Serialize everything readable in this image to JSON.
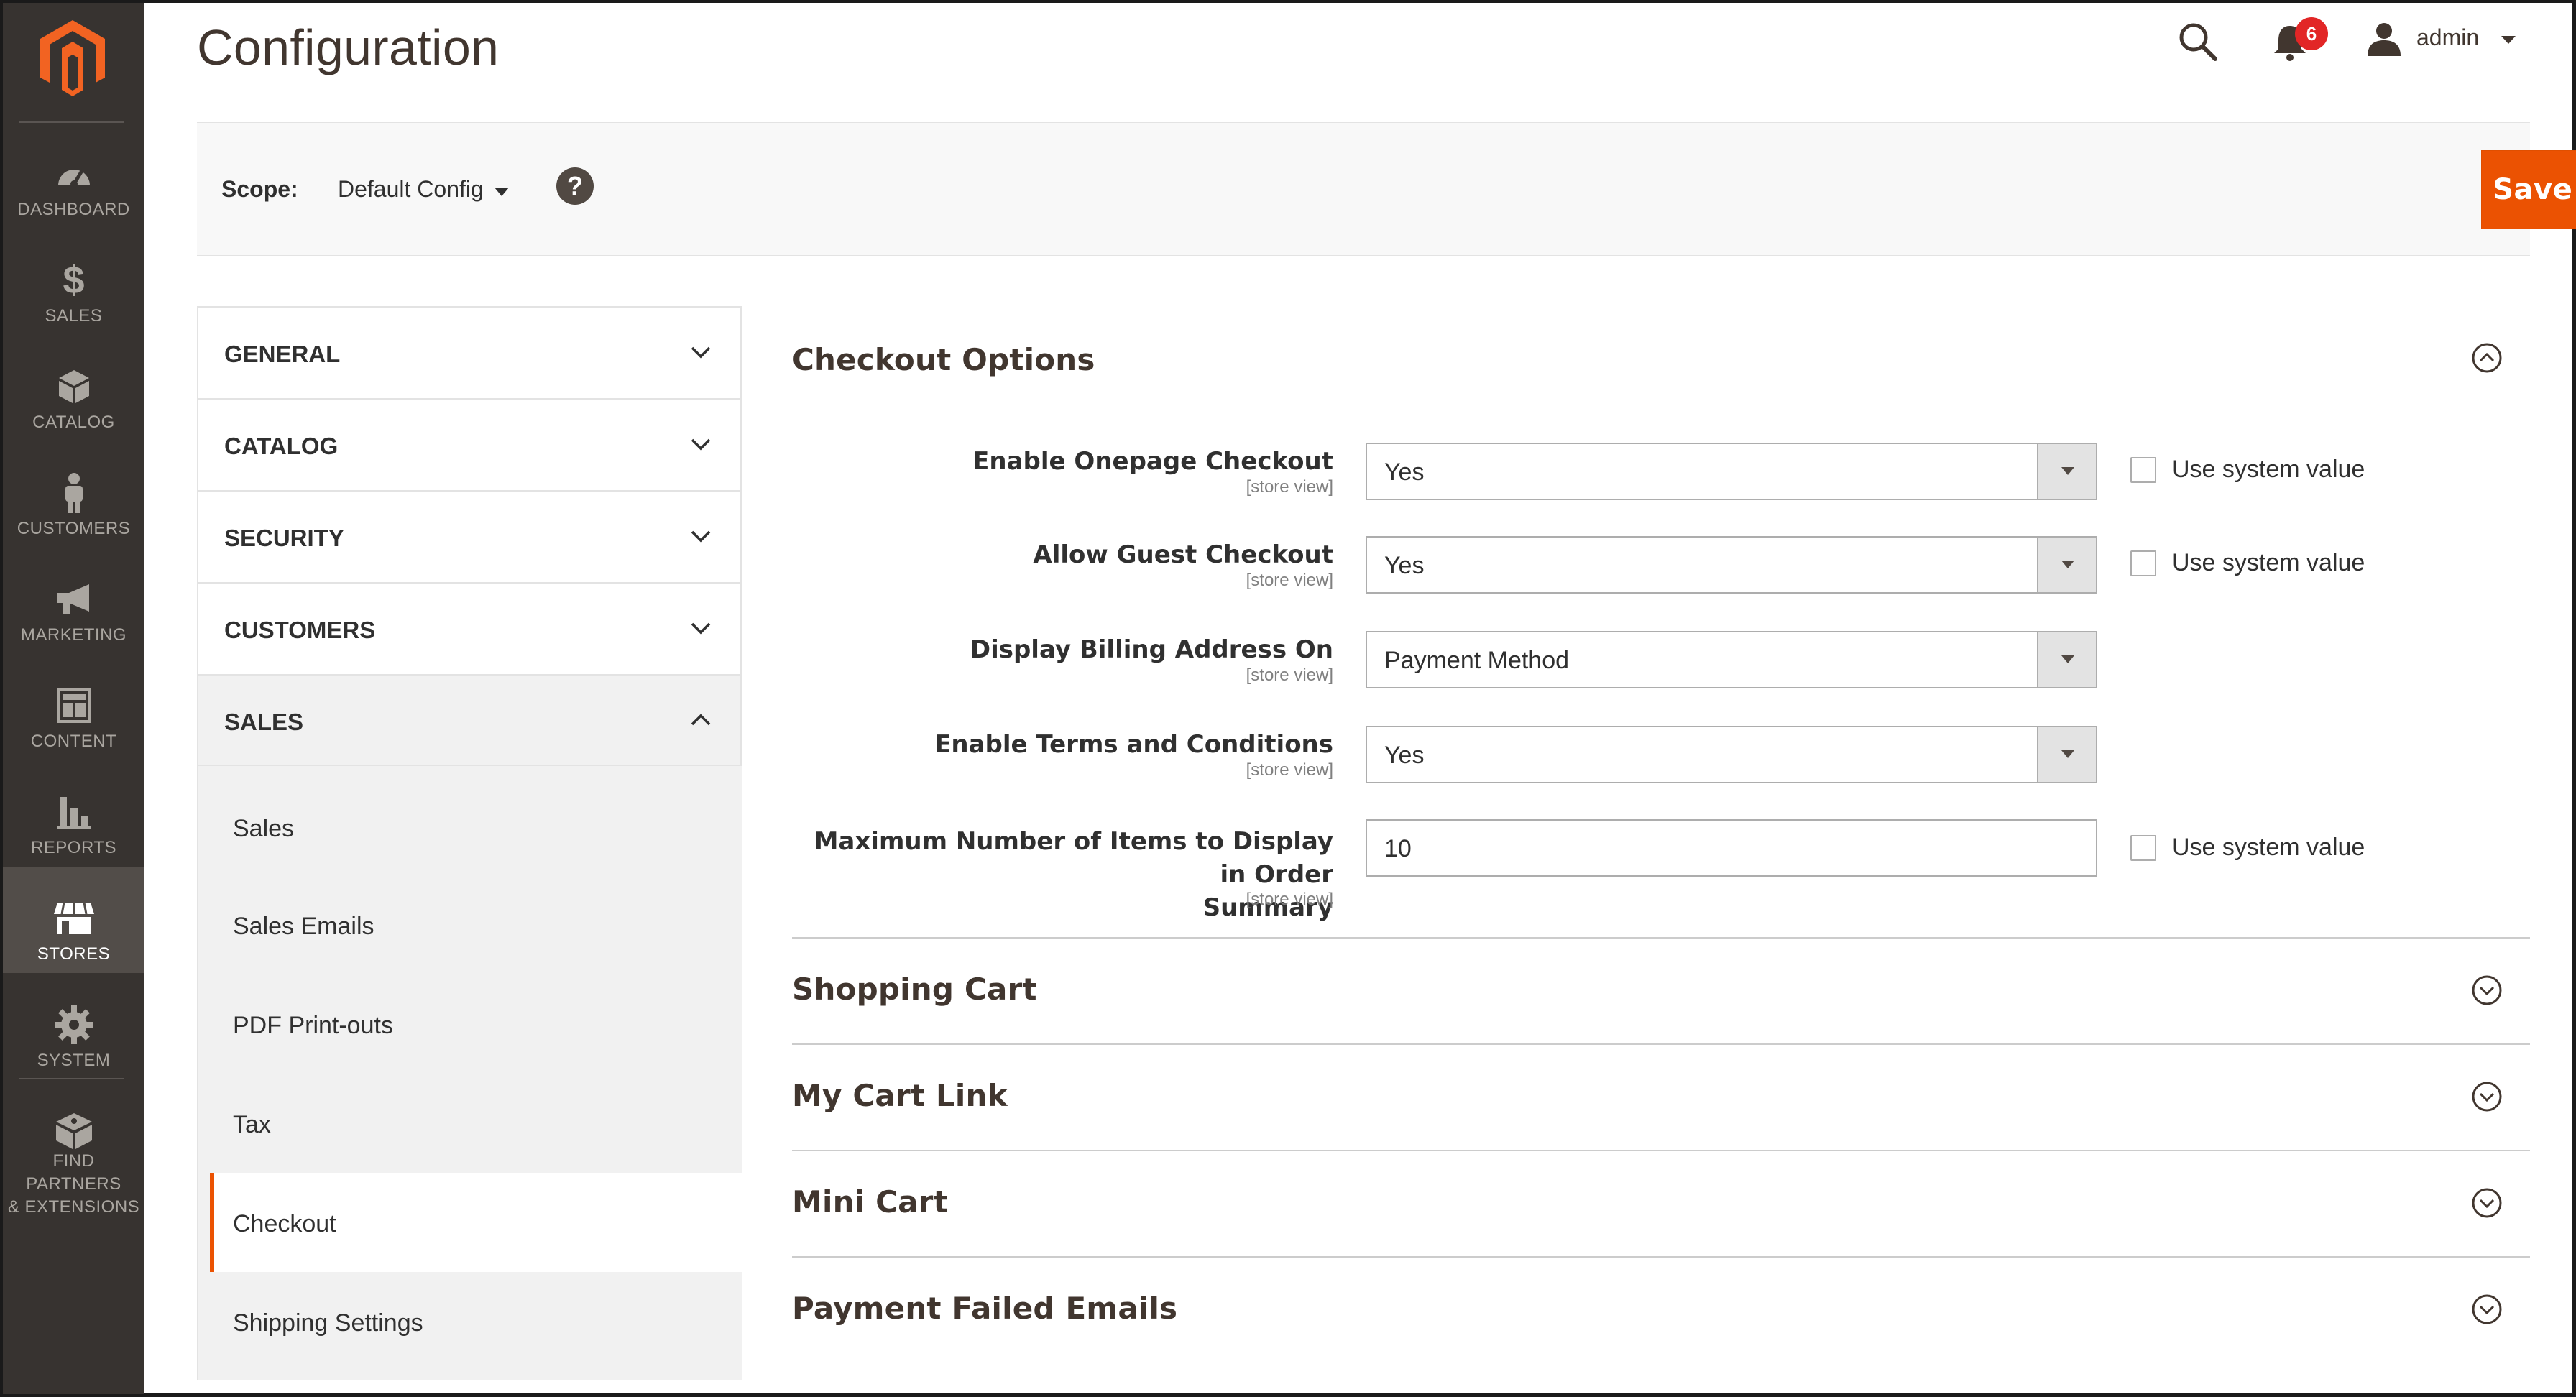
{
  "header": {
    "page_title": "Configuration",
    "notifications_count": "6",
    "user_name": "admin"
  },
  "sidebar": {
    "items": [
      {
        "label": "DASHBOARD",
        "icon": "dashboard-icon"
      },
      {
        "label": "SALES",
        "icon": "dollar-icon"
      },
      {
        "label": "CATALOG",
        "icon": "box-icon"
      },
      {
        "label": "CUSTOMERS",
        "icon": "person-icon"
      },
      {
        "label": "MARKETING",
        "icon": "megaphone-icon"
      },
      {
        "label": "CONTENT",
        "icon": "layout-icon"
      },
      {
        "label": "REPORTS",
        "icon": "bar-chart-icon"
      },
      {
        "label": "STORES",
        "icon": "store-icon",
        "active": true
      },
      {
        "label": "SYSTEM",
        "icon": "gear-icon"
      },
      {
        "label": "FIND PARTNERS",
        "label2": "& EXTENSIONS",
        "icon": "blocks-icon"
      }
    ]
  },
  "scope": {
    "label": "Scope:",
    "value": "Default Config",
    "help": "?"
  },
  "actions": {
    "save_label": "Save Config"
  },
  "tabs": [
    {
      "label": "GENERAL",
      "open": false
    },
    {
      "label": "CATALOG",
      "open": false
    },
    {
      "label": "SECURITY",
      "open": false
    },
    {
      "label": "CUSTOMERS",
      "open": false
    },
    {
      "label": "SALES",
      "open": true,
      "items": [
        "Sales",
        "Sales Emails",
        "PDF Print-outs",
        "Tax",
        "Checkout",
        "Shipping Settings"
      ],
      "active_item": "Checkout"
    }
  ],
  "sections": {
    "checkout_options": {
      "title": "Checkout Options",
      "fields": [
        {
          "label": "Enable Onepage Checkout",
          "scope": "[store view]",
          "value": "Yes",
          "use_system": "Use system value"
        },
        {
          "label": "Allow Guest Checkout",
          "scope": "[store view]",
          "value": "Yes",
          "use_system": "Use system value"
        },
        {
          "label": "Display Billing Address On",
          "scope": "[store view]",
          "value": "Payment Method"
        },
        {
          "label": "Enable Terms and Conditions",
          "scope": "[store view]",
          "value": "Yes"
        },
        {
          "label_line1": "Maximum Number of Items to Display in Order",
          "label_line2": "Summary",
          "scope": "[store view]",
          "value": "10",
          "use_system": "Use system value"
        }
      ]
    },
    "collapsed": [
      {
        "title": "Shopping Cart"
      },
      {
        "title": "My Cart Link"
      },
      {
        "title": "Mini Cart"
      },
      {
        "title": "Payment Failed Emails"
      }
    ]
  }
}
